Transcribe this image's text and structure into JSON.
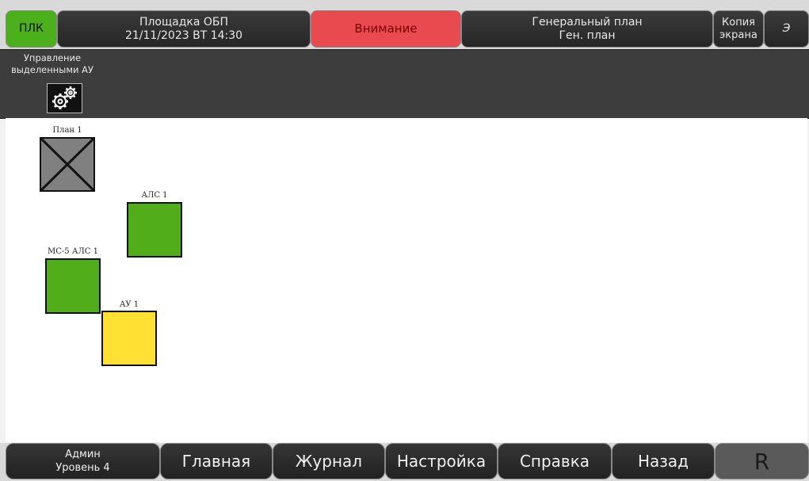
{
  "header": {
    "plc_label": "ПЛК",
    "site_name": "Площадка ОБП",
    "datetime": "21/11/2023 ВТ 14:30",
    "alert_label": "Внимание",
    "plan_title": "Генеральный план",
    "plan_subtitle": "Ген. план",
    "screenshot_line1": "Копия",
    "screenshot_line2": "экрана",
    "extra_label": "Э"
  },
  "toolbar": {
    "manage_line1": "Управление",
    "manage_line2": "выделенными АУ",
    "manage_icon": "gears-icon"
  },
  "canvas": {
    "objects": [
      {
        "label": "План 1",
        "kind": "plan",
        "color": "#808080"
      },
      {
        "label": "АЛС 1",
        "kind": "device",
        "color": "#52ad1a"
      },
      {
        "label": "МС-5 АЛС 1",
        "kind": "device",
        "color": "#52ad1a"
      },
      {
        "label": "АУ 1",
        "kind": "device",
        "color": "#ffe033"
      }
    ]
  },
  "footer": {
    "user_name": "Админ",
    "user_level": "Уровень 4",
    "home": "Главная",
    "journal": "Журнал",
    "settings": "Настройка",
    "help": "Справка",
    "back": "Назад",
    "r_label": "R"
  },
  "colors": {
    "plc_green": "#4caf1c",
    "alert_red": "#e84a4f",
    "ok_green": "#52ad1a",
    "warning_yellow": "#ffe033",
    "plan_gray": "#808080"
  }
}
